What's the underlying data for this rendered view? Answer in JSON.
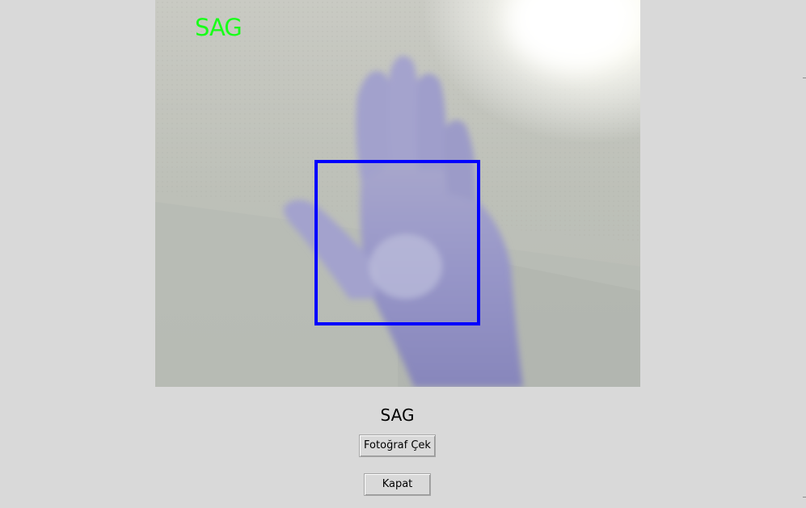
{
  "camera": {
    "overlay_text": "SAG",
    "overlay_color": "#19ff19",
    "roi_color": "#0000ff"
  },
  "prediction": {
    "text": "SAG"
  },
  "buttons": {
    "capture_label": "Fotoğraf Çek",
    "close_label": "Kapat"
  }
}
